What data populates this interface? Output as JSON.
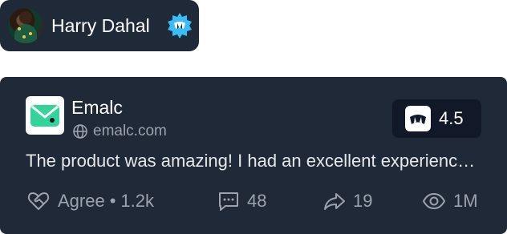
{
  "user": {
    "name": "Harry Dahal"
  },
  "review": {
    "brand": {
      "name": "Emalc",
      "domain": "emalc.com"
    },
    "rating": "4.5",
    "text": "The product was amazing! I had an excellent experience with it.",
    "stats": {
      "agree_label": "Agree",
      "agree_count": "1.2k",
      "comments": "48",
      "shares": "19",
      "views": "1M"
    }
  },
  "colors": {
    "card_bg": "#1f2937",
    "brand_green": "#34d399",
    "verified_blue": "#38bdf8",
    "muted_text": "#9ca3af"
  },
  "icons": [
    "verified-badge-icon",
    "globe-icon",
    "brand-logo-icon",
    "rating-logo-icon",
    "heart-handshake-icon",
    "comment-icon",
    "share-icon",
    "eye-icon"
  ]
}
